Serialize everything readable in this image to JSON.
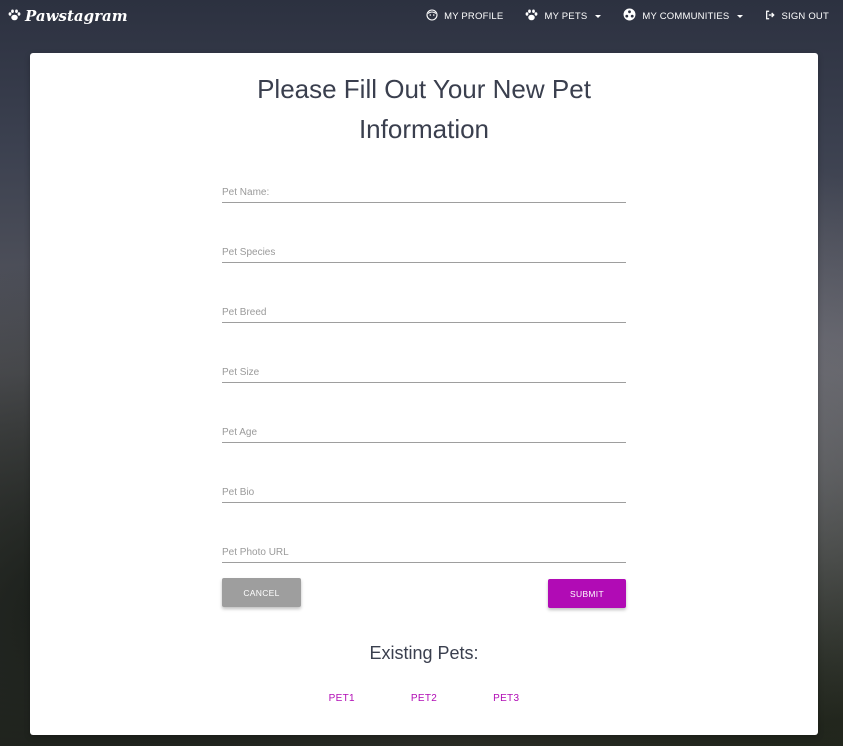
{
  "nav": {
    "brand": "Pawstagram",
    "items": [
      {
        "label": "MY PROFILE",
        "icon": "face-icon"
      },
      {
        "label": "MY PETS",
        "icon": "paw-icon",
        "dropdown": true
      },
      {
        "label": "MY COMMUNITIES",
        "icon": "community-icon",
        "dropdown": true
      },
      {
        "label": "SIGN OUT",
        "icon": "sign-out-icon"
      }
    ]
  },
  "form": {
    "title_line1": "Please Fill Out Your New Pet",
    "title_line2": "Information",
    "fields": {
      "name": {
        "placeholder": "Pet Name:",
        "value": ""
      },
      "species": {
        "placeholder": "Pet Species",
        "value": ""
      },
      "breed": {
        "placeholder": "Pet Breed",
        "value": ""
      },
      "size": {
        "placeholder": "Pet Size",
        "value": ""
      },
      "age": {
        "placeholder": "Pet Age",
        "value": ""
      },
      "bio": {
        "placeholder": "Pet Bio",
        "value": ""
      },
      "photo_url": {
        "placeholder": "Pet Photo URL",
        "value": ""
      }
    },
    "cancel_label": "CANCEL",
    "submit_label": "SUBMIT"
  },
  "existing": {
    "title": "Existing Pets:",
    "pets": [
      "PET1",
      "PET2",
      "PET3"
    ]
  },
  "colors": {
    "accent": "#b10bb5",
    "cancel": "#9e9e9e",
    "title_text": "#3a3f4e"
  }
}
